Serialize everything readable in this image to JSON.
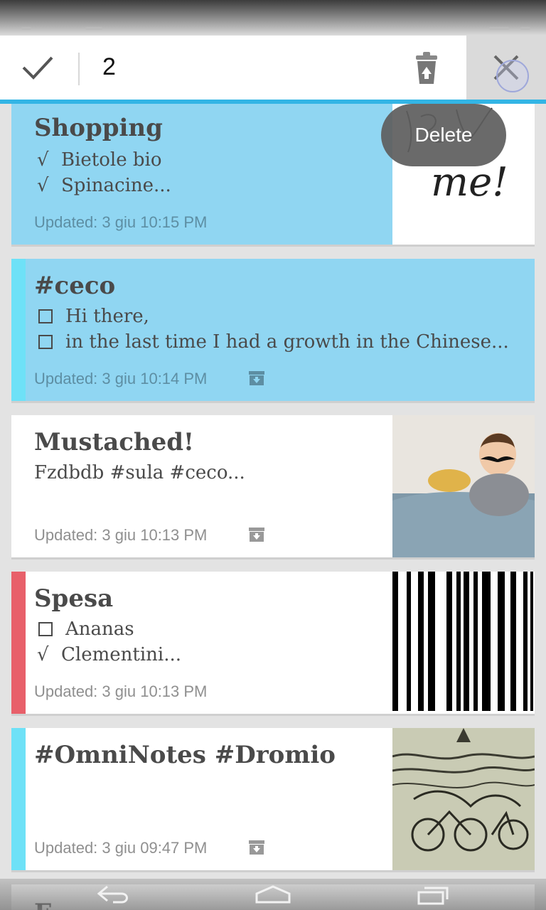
{
  "action_bar": {
    "selection_count": "2",
    "icons": [
      "check-icon",
      "trash-icon",
      "close-icon"
    ]
  },
  "toast": {
    "label": "Delete"
  },
  "notes": [
    {
      "title": "Shopping",
      "lines": [
        {
          "mark": "√",
          "text": "Bietole bio"
        },
        {
          "mark": "√",
          "text": "Spinacine..."
        }
      ],
      "updated": "Updated: 3 giu 10:15 PM",
      "selected": true,
      "thumbnail_text": "me!"
    },
    {
      "title": "#ceco",
      "lines": [
        {
          "mark": "☐",
          "text": "Hi there,"
        },
        {
          "mark": "☐",
          "text": "in the last time I had a growth in the Chinese..."
        }
      ],
      "updated": "Updated: 3 giu 10:14 PM",
      "selected": true,
      "category_color": "#6ee1f7"
    },
    {
      "title": "Mustached!",
      "content": "Fzdbdb #sula #ceco...",
      "updated": "Updated: 3 giu 10:13 PM",
      "selected": false
    },
    {
      "title": "Spesa",
      "lines": [
        {
          "mark": "☐",
          "text": "Ananas"
        },
        {
          "mark": "√",
          "text": "Clementini..."
        }
      ],
      "updated": "Updated: 3 giu 10:13 PM",
      "selected": false,
      "category_color": "#e8606a"
    },
    {
      "title": "#OmniNotes #Dromio",
      "updated": "Updated: 3 giu 09:47 PM",
      "selected": false,
      "category_color": "#6ee1f7"
    }
  ],
  "next_note_title_fragment": "F",
  "colors": {
    "accent": "#33b5e5",
    "selected_card": "#90d6f2",
    "background": "#e3e3e3"
  },
  "nav": [
    "back-icon",
    "home-icon",
    "recent-apps-icon"
  ]
}
